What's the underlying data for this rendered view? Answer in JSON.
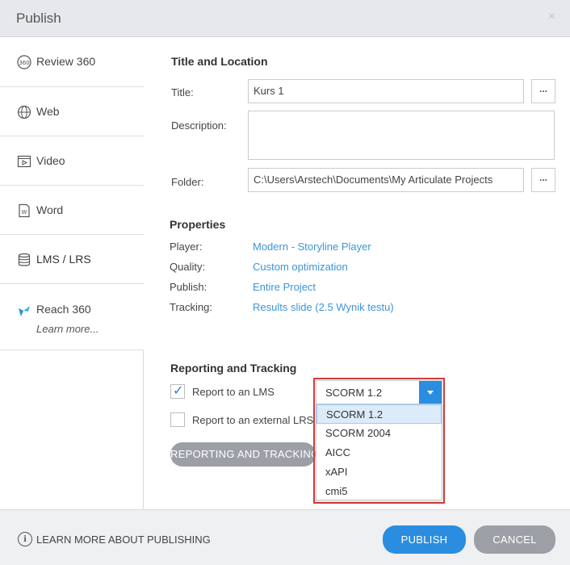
{
  "window": {
    "title": "Publish",
    "close": "×"
  },
  "sidebar": {
    "items": [
      {
        "label": "Review 360",
        "icon": "review360-icon"
      },
      {
        "label": "Web",
        "icon": "globe-icon"
      },
      {
        "label": "Video",
        "icon": "video-icon"
      },
      {
        "label": "Word",
        "icon": "word-doc-icon"
      },
      {
        "label": "LMS / LRS",
        "icon": "database-icon"
      },
      {
        "label": "Reach 360",
        "icon": "reach360-icon",
        "sub": "Learn more..."
      }
    ],
    "active": "LMS / LRS"
  },
  "title_location": {
    "heading": "Title and Location",
    "title_label": "Title:",
    "title_value": "Kurs 1",
    "description_label": "Description:",
    "description_value": "",
    "folder_label": "Folder:",
    "folder_value": "C:\\Users\\Arstech\\Documents\\My Articulate Projects",
    "browse_label": "..."
  },
  "properties": {
    "heading": "Properties",
    "rows": [
      {
        "label": "Player:",
        "value": "Modern - Storyline Player"
      },
      {
        "label": "Quality:",
        "value": "Custom optimization"
      },
      {
        "label": "Publish:",
        "value": "Entire Project"
      },
      {
        "label": "Tracking:",
        "value": "Results slide (2.5 Wynik testu)"
      }
    ]
  },
  "reporting": {
    "heading": "Reporting and Tracking",
    "report_lms_label": "Report to an LMS",
    "report_lms_checked": true,
    "report_lrs_label": "Report to an external LRS",
    "report_lrs_checked": false,
    "button_label": "REPORTING AND TRACKING...",
    "lms_select": {
      "value": "SCORM 1.2",
      "options": [
        "SCORM 1.2",
        "SCORM 2004",
        "AICC",
        "xAPI",
        "cmi5"
      ]
    }
  },
  "footer": {
    "learn_more": "LEARN MORE ABOUT PUBLISHING",
    "publish": "PUBLISH",
    "cancel": "CANCEL"
  },
  "colors": {
    "accent": "#2a8de0",
    "link": "#3b95d6",
    "highlight": "#d43b3b"
  }
}
